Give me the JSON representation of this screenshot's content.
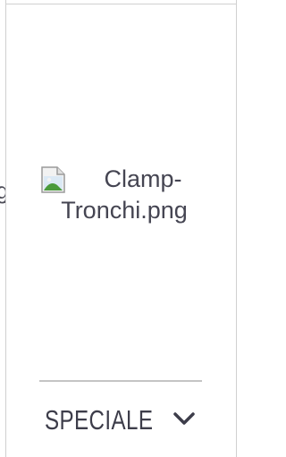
{
  "previous_item": {
    "partial_text": "g"
  },
  "image": {
    "alt_text_line1": "Clamp-",
    "alt_text_line2": "Tronchi.png",
    "icon": "broken-image-icon"
  },
  "section": {
    "label": "SPECIALE",
    "icon": "chevron-down-icon"
  },
  "colors": {
    "text": "#454552",
    "divider": "#c4c4c4",
    "frame": "#d0d0d0"
  }
}
